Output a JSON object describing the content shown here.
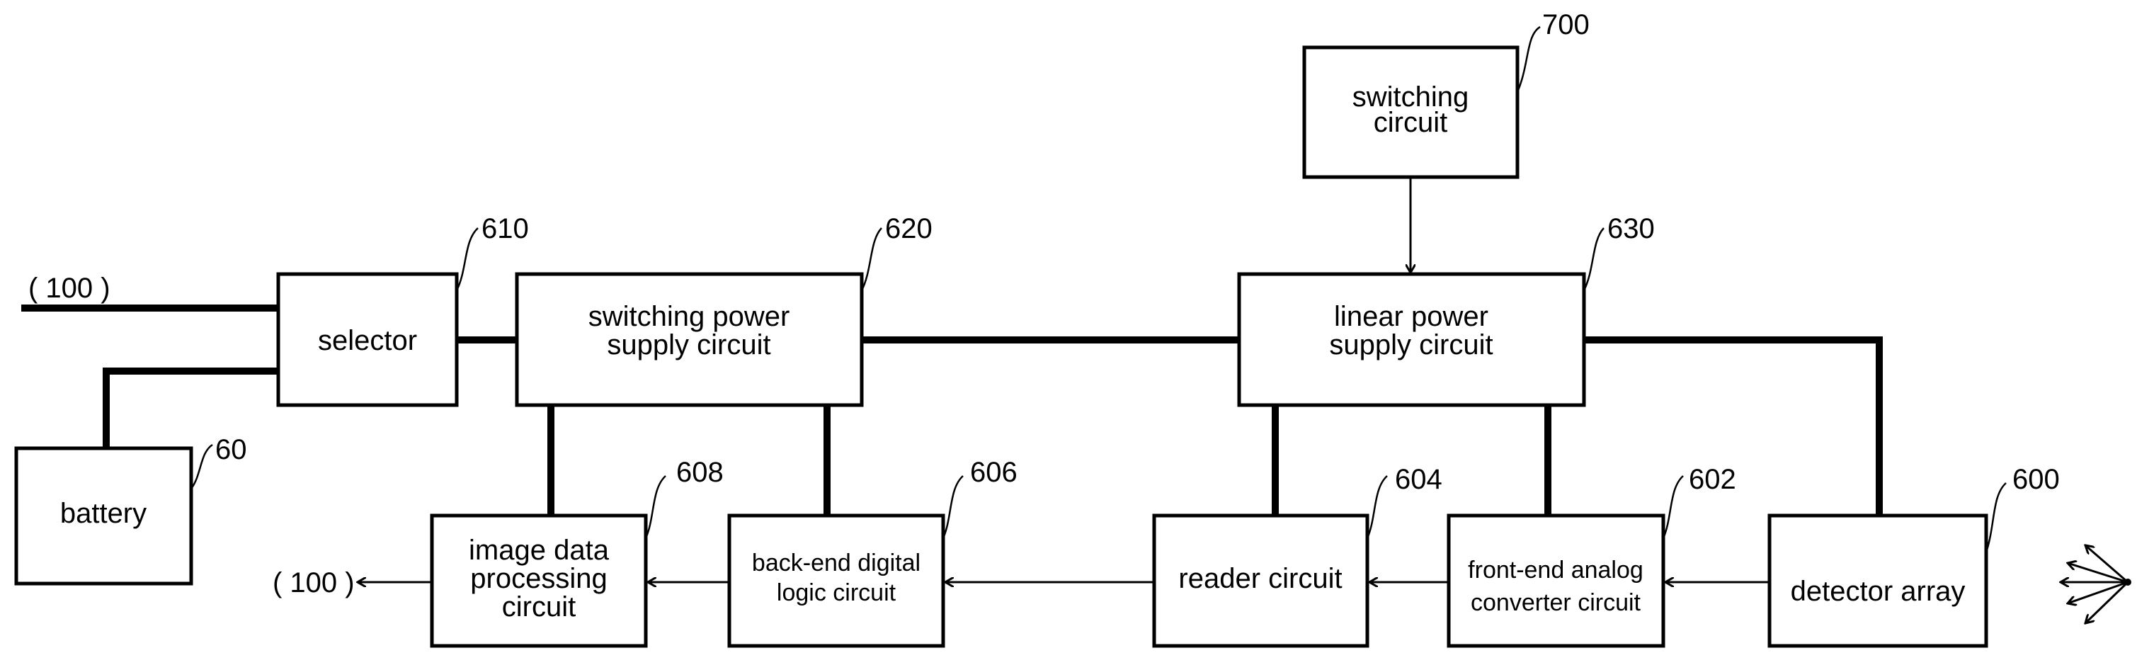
{
  "diagram": {
    "external_in_label": "( 100 )",
    "external_out_label": "( 100 )",
    "blocks": {
      "switching_circuit": {
        "ref": "700",
        "line1": "switching",
        "line2": "circuit"
      },
      "selector": {
        "ref": "610",
        "line1": "selector"
      },
      "switching_power": {
        "ref": "620",
        "line1": "switching power",
        "line2": "supply circuit"
      },
      "linear_power": {
        "ref": "630",
        "line1": "linear power",
        "line2": "supply circuit"
      },
      "battery": {
        "ref": "60",
        "line1": "battery"
      },
      "image_data": {
        "ref": "608",
        "line1": "image data",
        "line2": "processing",
        "line3": "circuit"
      },
      "back_end": {
        "ref": "606",
        "line1": "back-end digital",
        "line2": "logic circuit"
      },
      "reader": {
        "ref": "604",
        "line1": "reader circuit"
      },
      "front_end": {
        "ref": "602",
        "line1": "front-end analog",
        "line2": "converter circuit"
      },
      "detector": {
        "ref": "600",
        "line1": "detector array"
      }
    }
  }
}
